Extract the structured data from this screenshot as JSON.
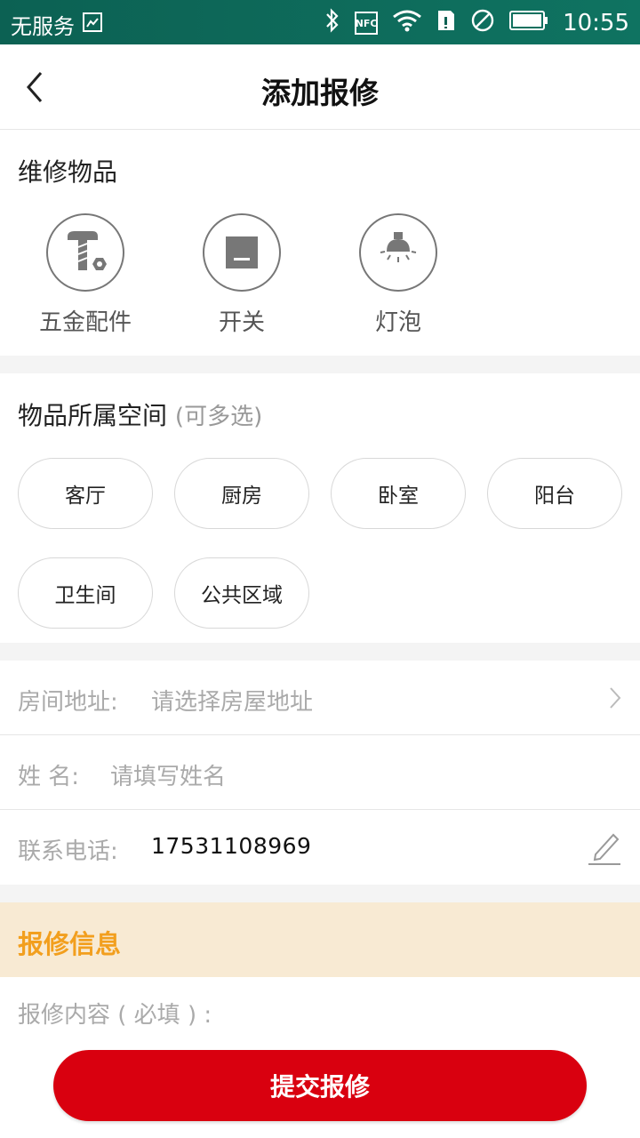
{
  "status_bar": {
    "carrier": "无服务",
    "time": "10:55",
    "nfc": "NFC"
  },
  "header": {
    "title": "添加报修"
  },
  "repair_items": {
    "title": "维修物品",
    "items": [
      {
        "label": "五金配件",
        "icon": "hardware-icon"
      },
      {
        "label": "开关",
        "icon": "switch-icon"
      },
      {
        "label": "灯泡",
        "icon": "bulb-icon"
      }
    ]
  },
  "space": {
    "title": "物品所属空间",
    "hint": "(可多选)",
    "options": [
      "客厅",
      "厨房",
      "卧室",
      "阳台",
      "卫生间",
      "公共区域"
    ]
  },
  "form": {
    "address_label": "房间地址:",
    "address_placeholder": "请选择房屋地址",
    "name_label": "姓 名:",
    "name_placeholder": "请填写姓名",
    "phone_label": "联系电话:",
    "phone_value": "17531108969"
  },
  "repair_info": {
    "title": "报修信息",
    "content_label": "报修内容 ( 必填 ) :"
  },
  "submit_label": "提交报修",
  "colors": {
    "accent": "#d9000f",
    "info_title": "#f29f1e",
    "info_bg": "#f8ead3"
  }
}
